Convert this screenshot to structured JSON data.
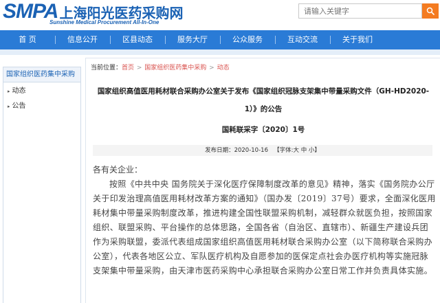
{
  "header": {
    "logo_text": "SMPA",
    "logo_cn": "上海阳光医药采购网",
    "logo_en": "Sunshine Medical Procurement All-In-One",
    "search_placeholder": "请输入关键字",
    "search_icon": "search-icon",
    "accent_color": "#f47b20",
    "brand_color": "#1b62b4"
  },
  "nav": {
    "items": [
      {
        "label": "首 页"
      },
      {
        "label": "信息公开"
      },
      {
        "label": "区县动态"
      },
      {
        "label": "服务大厅"
      },
      {
        "label": "公众服务"
      },
      {
        "label": "互动交流"
      },
      {
        "label": "关于我们"
      }
    ],
    "color": "#2a7bd6"
  },
  "sidebar": {
    "title": "国家组织医药集中采购",
    "items": [
      {
        "label": "动态"
      },
      {
        "label": "公告"
      }
    ]
  },
  "breadcrumb": {
    "prefix": "当前位置：",
    "items": [
      "首页",
      "国家组织医药集中采购",
      "动态"
    ]
  },
  "article": {
    "title_line1": "国家组织高值医用耗材联合采购办公室关于发布《国家组织冠脉支架集中带量采购文件（GH-HD2020-",
    "title_line2": "1）》的公告",
    "doc_number": "国耗联采字〔2020〕1号",
    "publish_label": "发布日期：",
    "publish_date": "2020-10-16",
    "font_size_label": "【字体:",
    "font_sizes": [
      "大",
      "中",
      "小"
    ],
    "font_size_end": "】",
    "greeting": "各有关企业：",
    "body": "按照《中共中央 国务院关于深化医疗保障制度改革的意见》精神，落实《国务院办公厅关于印发治理高值医用耗材改革方案的通知》（国办发〔2019〕37号）要求，全面深化医用耗材集中带量采购制度改革，推进构建全国性联盟采购机制，减轻群众就医负担，按照国家组织、联盟采购、平台操作的总体思路，全国各省（自治区、直辖市）、新疆生产建设兵团作为采购联盟，委派代表组成国家组织高值医用耗材联合采购办公室（以下简称联合采购办公室），代表各地区公立、军队医疗机构及自愿参加的医保定点社会办医疗机构等实施冠脉支架集中带量采购，由天津市医药采购中心承担联合采购办公室日常工作并负责具体实施。"
  }
}
